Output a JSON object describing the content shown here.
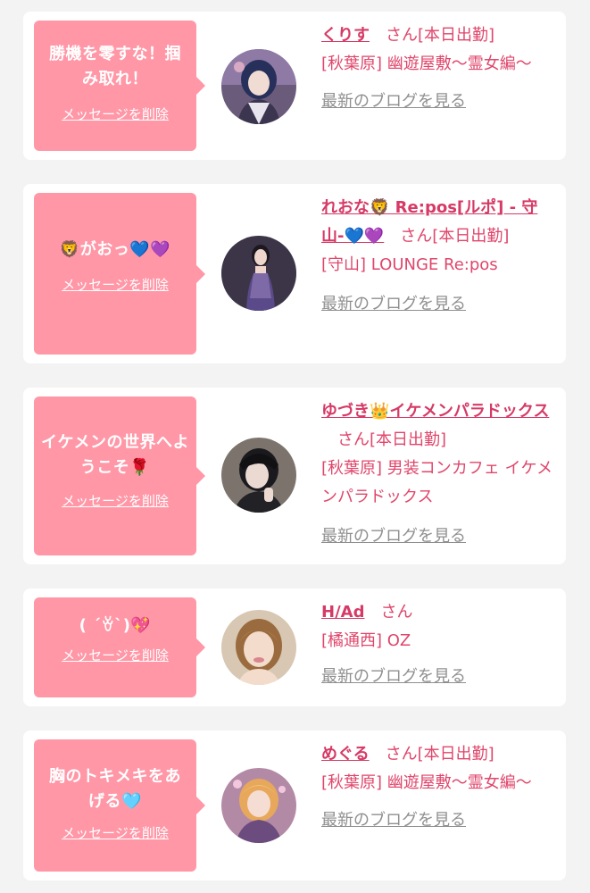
{
  "cards": [
    {
      "message": "勝機を零すな！掴み取れ！",
      "delete_label": "メッセージを削除",
      "cast_name": "くりす",
      "san": "さん",
      "status": "[本日出勤]",
      "shop": "[秋葉原] 幽遊屋敷〜霊女編〜",
      "blog_label": "最新のブログを見る"
    },
    {
      "message": "🦁がおっ💙💜",
      "delete_label": "メッセージを削除",
      "cast_name": "れおな🦁 Re:pos[ルポ] - 守山-💙💜",
      "san": "さん",
      "status": "[本日出勤]",
      "shop": "[守山] LOUNGE Re:pos",
      "blog_label": "最新のブログを見る"
    },
    {
      "message": "イケメンの世界へようこそ🌹",
      "delete_label": "メッセージを削除",
      "cast_name": "ゆづき👑イケメンパラドックス",
      "san": "さん",
      "status": "[本日出勤]",
      "shop": "[秋葉原] 男装コンカフェ イケメンパラドックス",
      "blog_label": "最新のブログを見る"
    },
    {
      "message": "( ´ꈊ`)💖",
      "delete_label": "メッセージを削除",
      "cast_name": "H/Ad",
      "san": "さん",
      "status": "",
      "shop": "[橘通西] OZ",
      "blog_label": "最新のブログを見る"
    },
    {
      "message": "胸のトキメキをあげる🩵",
      "delete_label": "メッセージを削除",
      "cast_name": "めぐる",
      "san": "さん",
      "status": "[本日出勤]",
      "shop": "[秋葉原] 幽遊屋敷〜霊女編〜",
      "blog_label": "最新のブログを見る"
    }
  ],
  "colors": {
    "bubble": "#ff97a7",
    "accent": "#d63a66",
    "link_gray": "#8f8f8f",
    "background": "#f3f3f3"
  },
  "icons": [
    "avatar-photo-icon"
  ]
}
